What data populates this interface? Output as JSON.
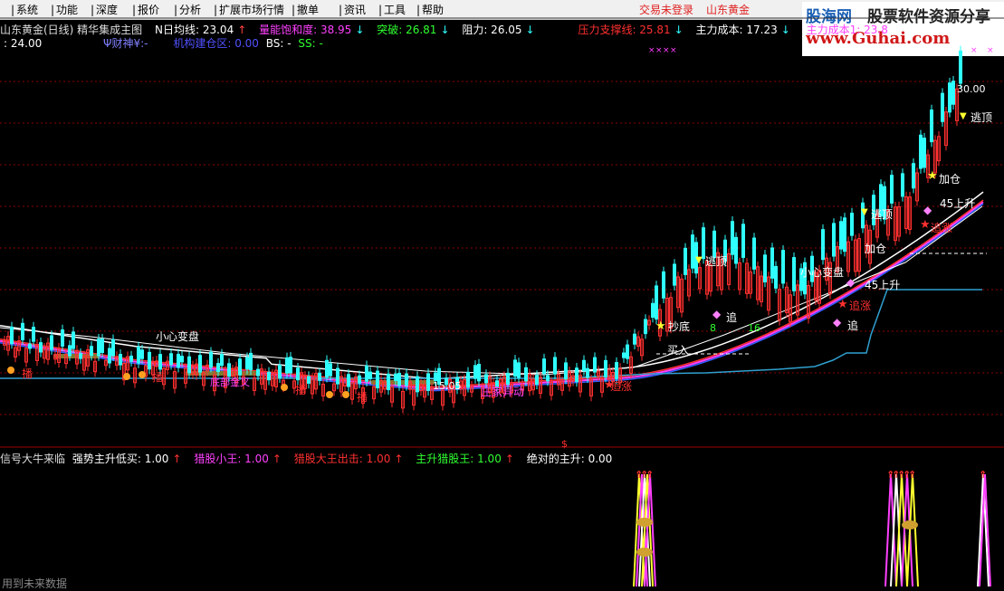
{
  "menu": {
    "items": [
      "系统",
      "功能",
      "深度",
      "报价",
      "分析",
      "扩展市场行情",
      "撤单",
      "资讯",
      "工具",
      "帮助"
    ],
    "status_login": "交易未登录",
    "status_name": "山东黄金"
  },
  "logo": {
    "brand": "股海网",
    "tagline": "股票软件资源分享",
    "url": "www.Guhai.com"
  },
  "indicator_line1": {
    "title": "山东黄金(日线) 精华集成主图",
    "n_ma": "N日均线: 23.04",
    "volume_sat": "量能饱和度: 38.95",
    "breakout": "突破: 26.81",
    "resistance": "阻力: 26.05",
    "support": "压力支撑线: 25.81",
    "main_cost": "主力成本: 17.23",
    "main_cost1": "主力成本1: 23.8"
  },
  "indicator_line2": {
    "value": ": 24.00",
    "wealth": "Ψ财神¥:-",
    "inst": "机构建仓区: 0.00",
    "bs": "BS: -",
    "ss": "SS: -"
  },
  "sub_legend": {
    "label1": "信号大牛来临",
    "label2": "强势主升低买: 1.00",
    "label3": "猎股小王: 1.00",
    "label4": "猎股大王出击: 1.00",
    "label5": "主升猎股王: 1.00",
    "label6": "绝对的主升: 0.00"
  },
  "annotations": {
    "high_price": "30.00",
    "low_price": "15.05",
    "escape_top": "逃顶",
    "add_pos": "加仓",
    "chase": "追涨",
    "chase_short": "追",
    "careful": "小心变盘",
    "rise45": "45上升",
    "banker": "庄家异动",
    "buy": "抄底",
    "buy_in": "买入",
    "bottom_gold": "底部金叉",
    "broadcast": "播",
    "dollar": "$",
    "num8": "8",
    "num16": "16",
    "num2": "2"
  },
  "footer": "用到未来数据",
  "colors": {
    "up": "#ff3030",
    "down": "#30ffff",
    "bg": "#000000",
    "grid": "#8b0000"
  },
  "chart_data": {
    "type": "candlestick",
    "title": "山东黄金(日线)",
    "ylim": [
      14,
      31
    ],
    "high_label": 30.0,
    "low_label": 15.05
  }
}
